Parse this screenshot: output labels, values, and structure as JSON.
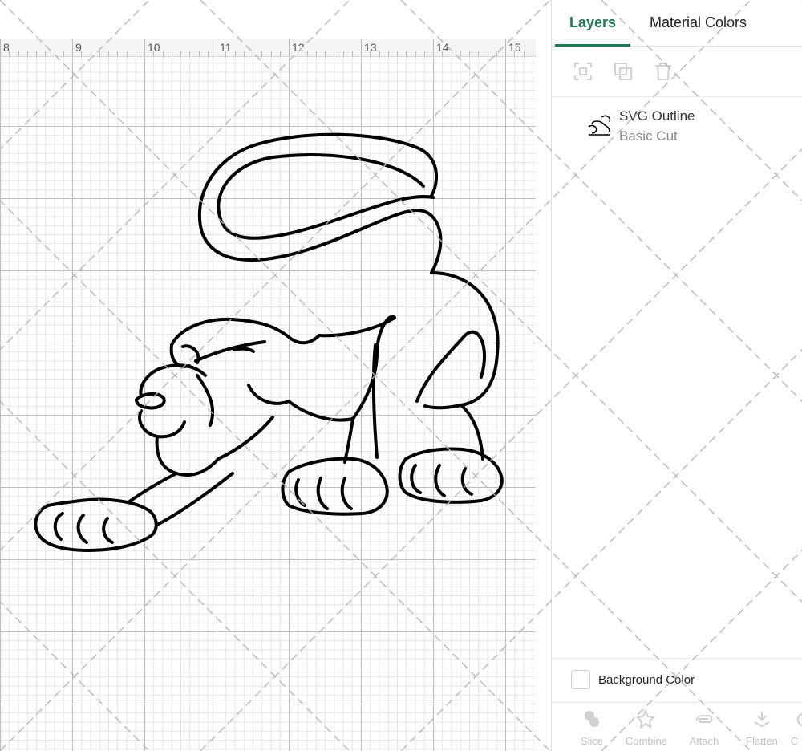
{
  "ruler": {
    "numbers": [
      "8",
      "9",
      "10",
      "11",
      "12",
      "13",
      "14",
      "15"
    ]
  },
  "canvas": {
    "artwork": "panther-outline",
    "stroke_color": "#000000"
  },
  "panel": {
    "tabs": [
      {
        "label": "Layers",
        "active": true
      },
      {
        "label": "Material Colors",
        "active": false
      }
    ],
    "toolbar_icons": [
      "group-icon",
      "duplicate-icon",
      "delete-icon"
    ],
    "layer": {
      "name": "SVG Outline",
      "operation": "Basic Cut"
    },
    "background": {
      "label": "Background Color",
      "checked": false
    },
    "bottom_actions": [
      {
        "label": "Slice",
        "icon": "slice-icon"
      },
      {
        "label": "Combine",
        "icon": "combine-icon"
      },
      {
        "label": "Attach",
        "icon": "attach-icon"
      },
      {
        "label": "Flatten",
        "icon": "flatten-icon"
      },
      {
        "label": "C",
        "icon": "contour-icon"
      }
    ]
  },
  "colors": {
    "accent": "#1c7a52",
    "disabled": "#c4c4c4"
  }
}
